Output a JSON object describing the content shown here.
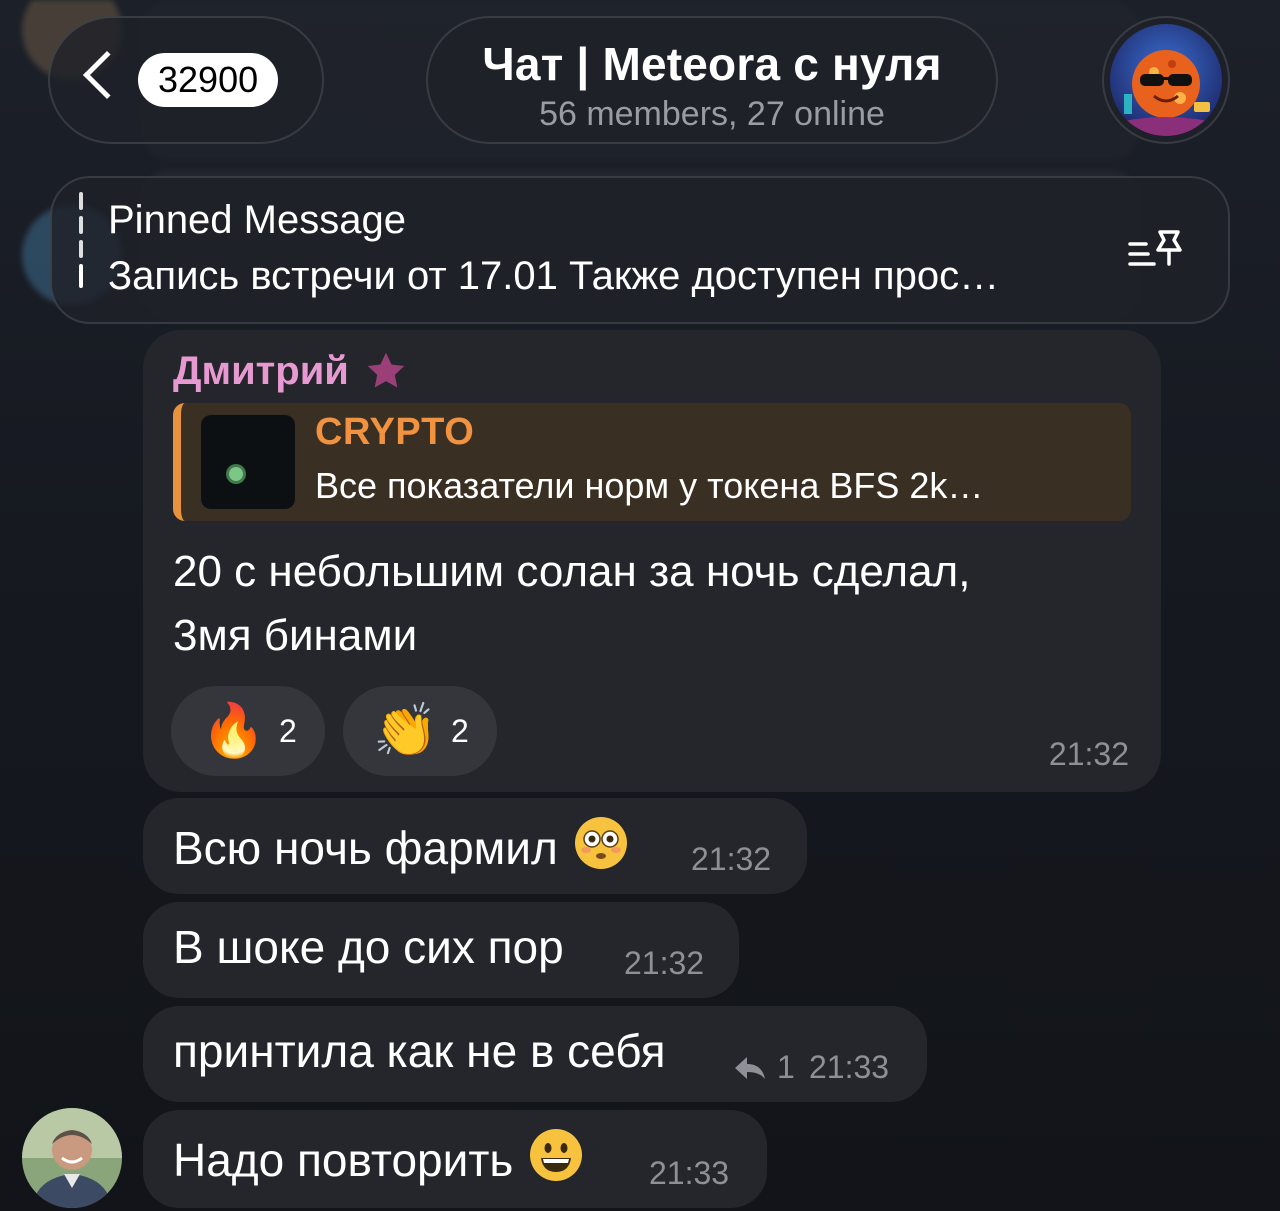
{
  "header": {
    "back_badge": "32900",
    "title": "Чат | Meteora с нуля",
    "subtitle": "56 members, 27 online"
  },
  "pinned": {
    "title": "Pinned Message",
    "text": "Запись встречи от 17.01 Также доступен прос…"
  },
  "messages": [
    {
      "sender": "Дмитрий",
      "reply": {
        "name": "CRYPTO",
        "text": "Все показатели норм у токена BFS 2k…"
      },
      "text_line1": "20 с небольшим солан за ночь сделал,",
      "text_line2": "3мя бинами",
      "reactions": [
        {
          "emoji": "🔥",
          "count": "2"
        },
        {
          "emoji": "👏",
          "count": "2"
        }
      ],
      "time": "21:32"
    },
    {
      "text": "Всю ночь фармил",
      "emoji": "flushed-face-emoji",
      "time": "21:32"
    },
    {
      "text": "В шоке до сих пор",
      "time": "21:32"
    },
    {
      "text": "принтила как не в себя",
      "reply_count": "1",
      "time": "21:33"
    },
    {
      "text": "Надо повторить",
      "emoji": "grinning-face-emoji",
      "time": "21:33"
    }
  ],
  "colors": {
    "sender": "#e79ad1",
    "reply_accent": "#f0923f",
    "bubble": "#24262b"
  }
}
